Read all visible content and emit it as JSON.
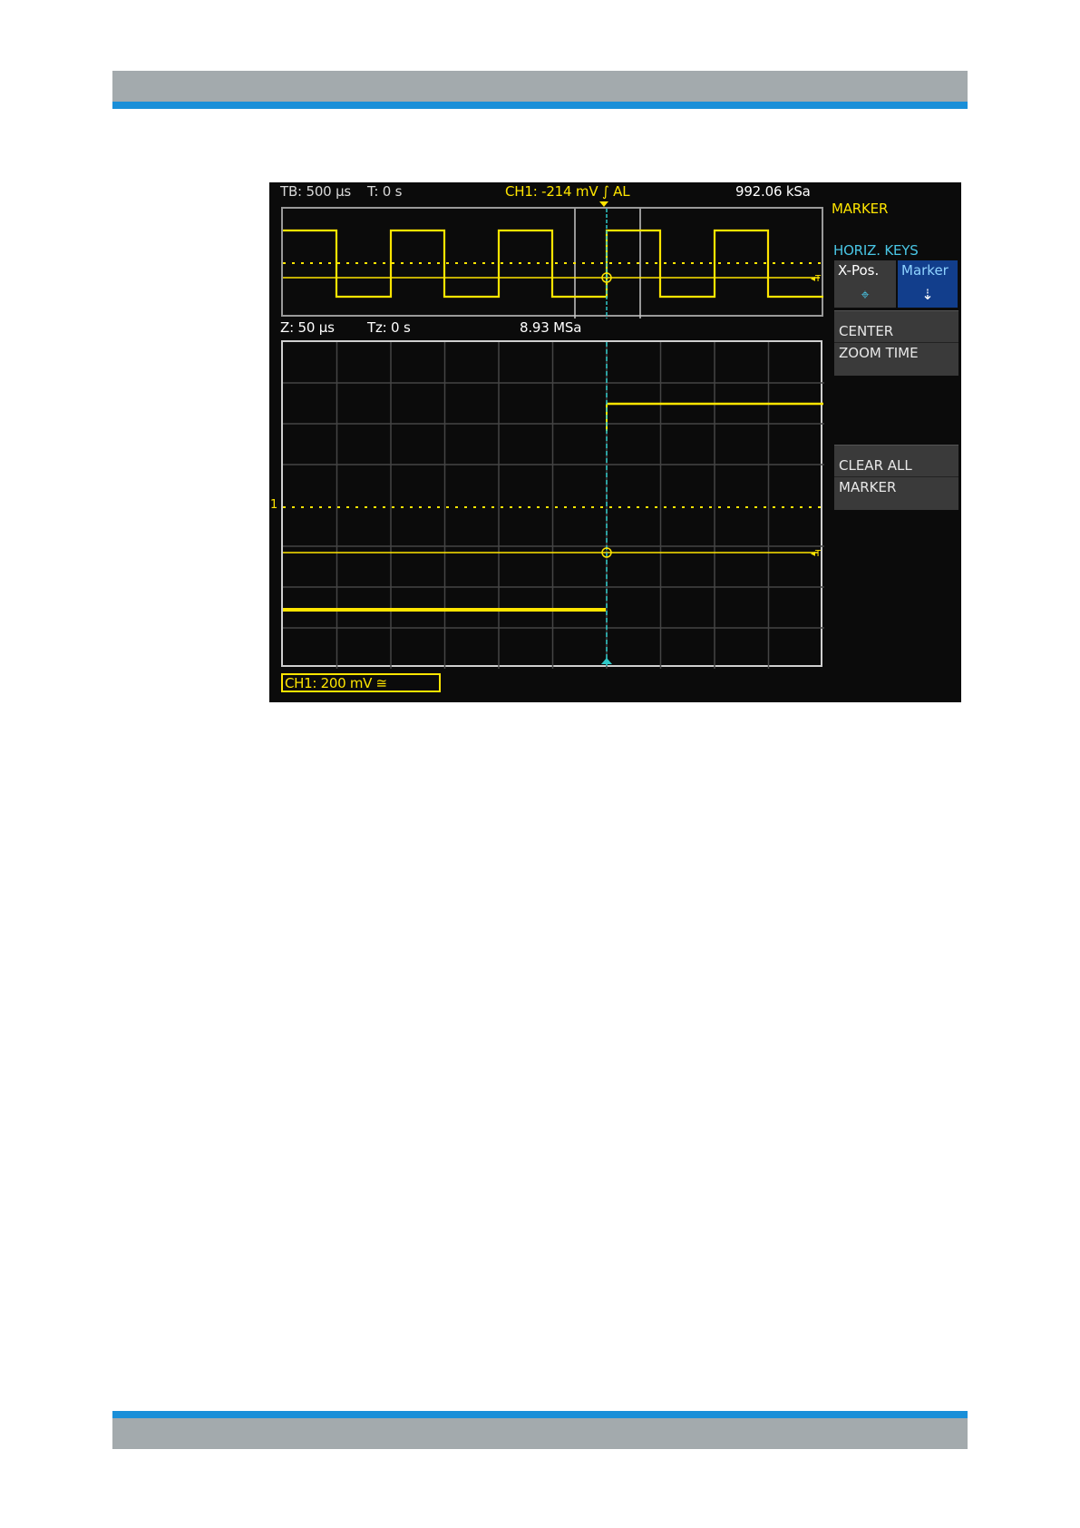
{
  "screen": {
    "top_status": {
      "timebase": "TB: 500 µs",
      "trigger_time": "T: 0 s",
      "channel_trigger": "CH1: -214 mV ∫ AL",
      "sample_rate": "992.06 kSa"
    },
    "zoom_status": {
      "zoom_timebase": "Z: 50 µs",
      "zoom_trigger_time": "Tz: 0 s",
      "zoom_sample_rate": "8.93 MSa"
    },
    "channel_badge": "CH1: 200 mV ≅",
    "channel_marker": "1"
  },
  "menu": {
    "title": "MARKER",
    "horiz_keys_label": "HORIZ. KEYS",
    "xpos_label": "X-Pos.",
    "marker_label": "Marker",
    "xpos_icon": "crosshair-icon",
    "marker_icon": "marker-arrow-icon",
    "center_zoom": [
      "CENTER",
      "ZOOM TIME"
    ],
    "clear_all": [
      "CLEAR ALL",
      "MARKER"
    ]
  },
  "colors": {
    "trace": "#ffe500",
    "marker": "#2fc9c9",
    "active_softkey": "#123e8c",
    "header_band": "#a3aaad",
    "accent_band": "#1a8fd8"
  }
}
